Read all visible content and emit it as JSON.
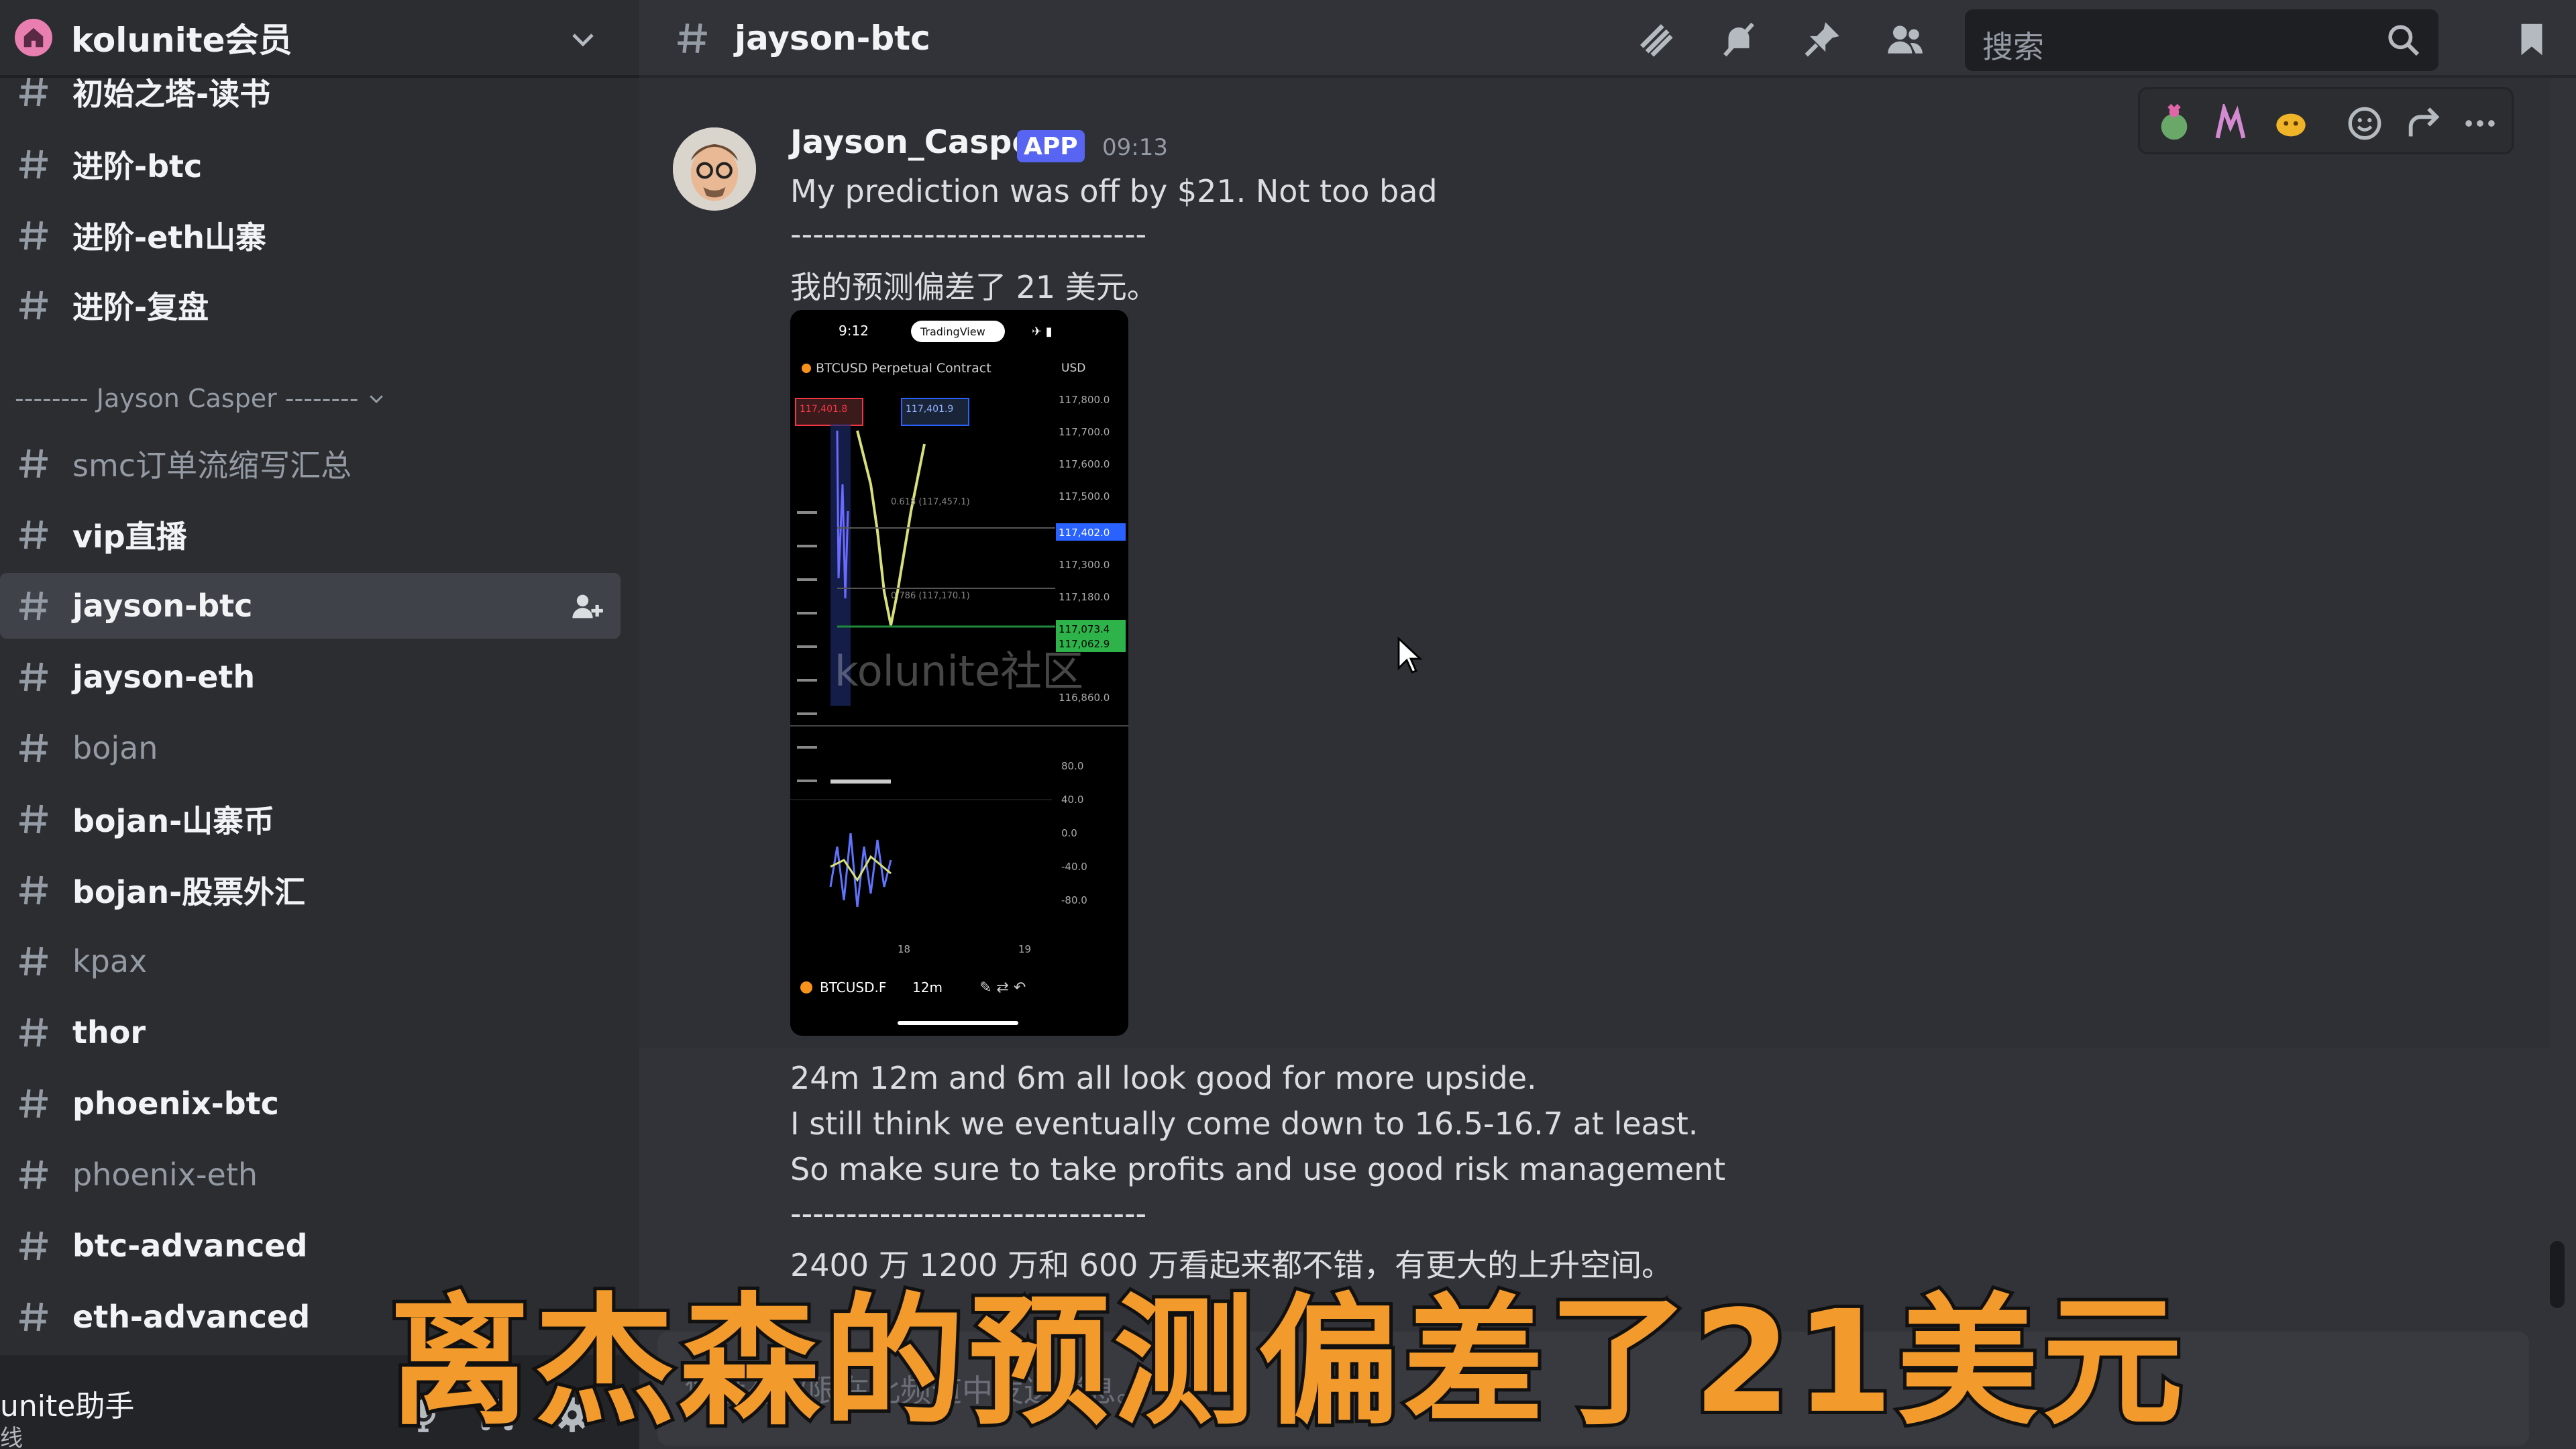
{
  "server": {
    "name": "kolunite会员"
  },
  "sidebar": {
    "channels_top": [
      {
        "label": "初始之塔-读书",
        "muted": false
      },
      {
        "label": "进阶-btc",
        "muted": false
      },
      {
        "label": "进阶-eth山寨",
        "muted": false
      },
      {
        "label": "进阶-复盘",
        "muted": false
      }
    ],
    "category": "-------- Jayson Casper --------",
    "channels": [
      {
        "label": "smc订单流缩写汇总",
        "muted": true
      },
      {
        "label": "vip直播",
        "muted": false
      },
      {
        "label": "jayson-btc",
        "muted": false,
        "active": true
      },
      {
        "label": "jayson-eth",
        "muted": false
      },
      {
        "label": "bojan",
        "muted": true
      },
      {
        "label": "bojan-山寨币",
        "muted": false
      },
      {
        "label": "bojan-股票外汇",
        "muted": false
      },
      {
        "label": "kpax",
        "muted": true
      },
      {
        "label": "thor",
        "muted": false
      },
      {
        "label": "phoenix-btc",
        "muted": false
      },
      {
        "label": "phoenix-eth",
        "muted": true
      },
      {
        "label": "btc-advanced",
        "muted": false
      },
      {
        "label": "eth-advanced",
        "muted": false
      }
    ]
  },
  "user": {
    "name": "unite助手",
    "status": "线"
  },
  "header": {
    "channel": "jayson-btc",
    "search_placeholder": "搜索"
  },
  "message": {
    "author": "Jayson_Casper",
    "badge": "APP",
    "time": "09:13",
    "lines_top": [
      "My prediction was off by $21. Not too bad",
      "--------------------------------",
      "我的预测偏差了 21 美元。"
    ],
    "lines_bottom": [
      "24m 12m and 6m all look good for more upside.",
      "I still think we eventually come down to 16.5-16.7 at least.",
      "So make sure to take profits and use good risk management",
      "--------------------------------",
      "2400 万 1200 万和 600 万看起来都不错，有更大的上升空间。"
    ]
  },
  "attachment": {
    "time": "9:12",
    "app": "TradingView",
    "symbol": "BTCUSD Perpetual Contract",
    "currency": "USD",
    "sell": "117,401.8",
    "buy": "117,401.9",
    "fib1": "0.618 (117,457.1)",
    "fib2": "0.786 (117,170.1)",
    "prices": [
      "117,800.0",
      "117,700.0",
      "117,600.0",
      "117,500.0",
      "117,402.0",
      "117,300.0",
      "117,180.0",
      "117,073.4",
      "117,062.9",
      "116,860.0"
    ],
    "osc": [
      "80.0",
      "40.0",
      "0.0",
      "-40.0",
      "-80.0"
    ],
    "days": [
      "18",
      "19"
    ],
    "watermark": "kolunite社区",
    "footer_symbol": "BTCUSD.F",
    "interval": "12m"
  },
  "composer": {
    "placeholder": "您没有权限在此频道中发送消息。"
  },
  "caption": "离杰森的预测偏差了21美元",
  "colors": {
    "accent": "#5865f2",
    "caption": "#f39a2c",
    "background": "#313338"
  }
}
